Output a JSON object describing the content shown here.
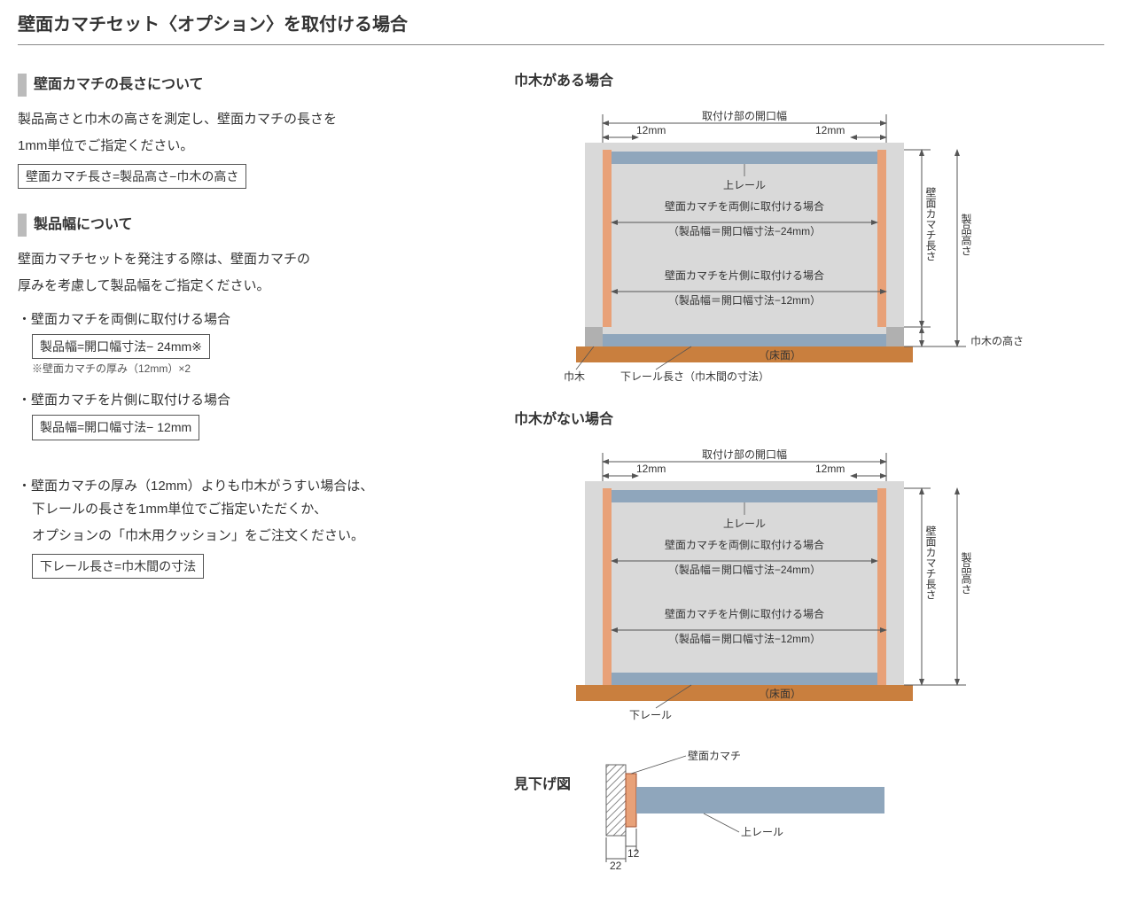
{
  "title": "壁面カマチセット〈オプション〉を取付ける場合",
  "left": {
    "sec1": {
      "head": "壁面カマチの長さについて",
      "p1": "製品高さと巾木の高さを測定し、壁面カマチの長さを",
      "p2": "1mm単位でご指定ください。",
      "formula": "壁面カマチ長さ=製品高さ−巾木の高さ"
    },
    "sec2": {
      "head": "製品幅について",
      "p1": "壁面カマチセットを発注する際は、壁面カマチの",
      "p2": "厚みを考慮して製品幅をご指定ください。",
      "b1": "・壁面カマチを両側に取付ける場合",
      "f1": "製品幅=開口幅寸法− 24mm※",
      "n1": "※壁面カマチの厚み（12mm）×2",
      "b2": "・壁面カマチを片側に取付ける場合",
      "f2": "製品幅=開口幅寸法− 12mm",
      "b3a": "・壁面カマチの厚み（12mm）よりも巾木がうすい場合は、",
      "b3b": "下レールの長さを1mm単位でご指定いただくか、",
      "b3c": "オプションの「巾木用クッション」をご注文ください。",
      "f3": "下レール長さ=巾木間の寸法"
    }
  },
  "diag": {
    "case1": "巾木がある場合",
    "case2": "巾木がない場合",
    "case3": "見下げ図",
    "openingWidth": "取付け部の開口幅",
    "mm12a": "12mm",
    "mm12b": "12mm",
    "upperRail": "上レール",
    "both1": "壁面カマチを両側に取付ける場合",
    "both2": "（製品幅＝開口幅寸法−24mm）",
    "one1": "壁面カマチを片側に取付ける場合",
    "one2": "（製品幅＝開口幅寸法−12mm）",
    "floor": "（床面）",
    "skirting": "巾木",
    "lowerRailLen": "下レール長さ（巾木間の寸法）",
    "lowerRail": "下レール",
    "kamachiLen": "壁面カマチ長さ",
    "prodHeight": "製品高さ",
    "skirtHeight": "巾木の高さ",
    "wallKamachi": "壁面カマチ",
    "dim12": "12",
    "dim22": "22"
  }
}
